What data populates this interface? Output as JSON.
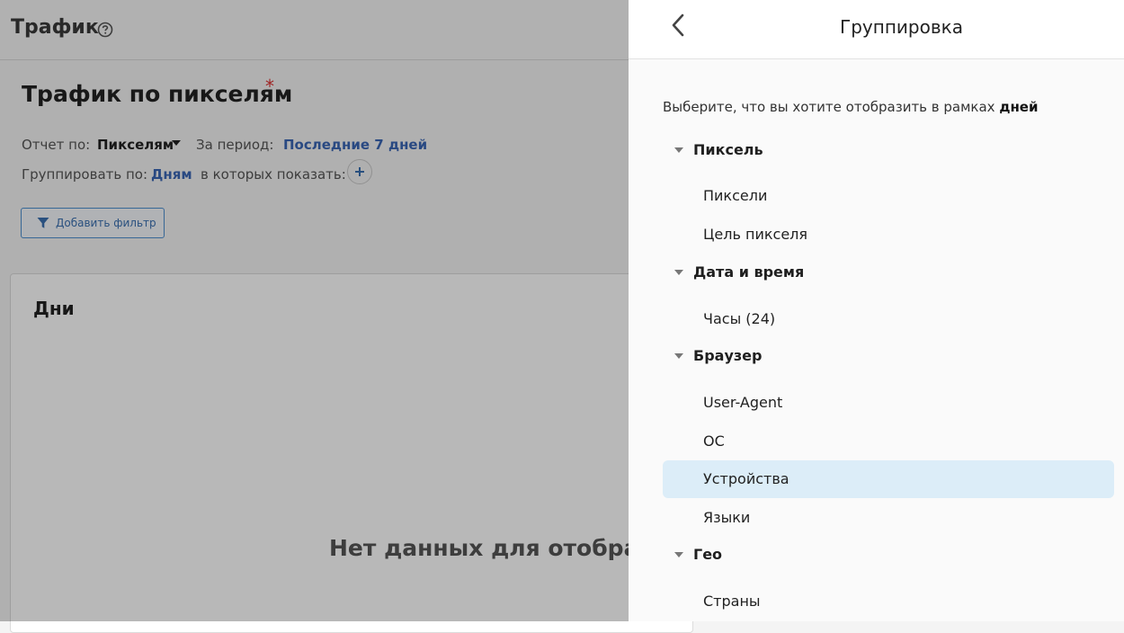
{
  "header": {
    "title": "Трафик"
  },
  "report": {
    "title": "Трафик по пикселям",
    "required_mark": "*",
    "report_by_label": "Отчет по:",
    "report_by_value": "Пикселям",
    "period_label": "За период:",
    "period_value": "Последние 7 дней",
    "group_by_label": "Группировать по:",
    "group_by_value": "Дням",
    "show_in_label": "в которых показать:",
    "add_filter_label": "Добавить фильтр"
  },
  "card": {
    "title": "Дни",
    "empty_message": "Нет данных для отображе"
  },
  "drawer": {
    "title": "Группировка",
    "hint_prefix": "Выберите, что вы хотите отобразить в рамках ",
    "hint_bold": "дней",
    "groups": [
      {
        "label": "Пиксель",
        "items": [
          "Пиксели",
          "Цель пикселя"
        ]
      },
      {
        "label": "Дата и время",
        "items": [
          "Часы (24)"
        ]
      },
      {
        "label": "Браузер",
        "items": [
          "User-Agent",
          "ОС",
          "Устройства",
          "Языки"
        ]
      },
      {
        "label": "Гео",
        "items": [
          "Страны"
        ]
      }
    ],
    "selected_item": "Устройства"
  },
  "colors": {
    "accent": "#3a66b5",
    "selected_bg": "#dcedf8",
    "required": "#dd3333"
  }
}
